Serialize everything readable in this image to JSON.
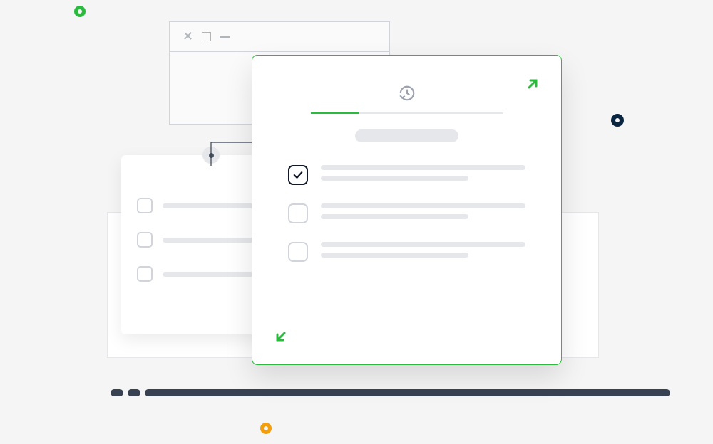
{
  "decorations": {
    "dots": [
      "green-ring",
      "navy-ring",
      "orange-ring"
    ]
  },
  "wire_window": {
    "controls": [
      "close",
      "maximize",
      "minimize"
    ]
  },
  "left_card": {
    "items": [
      {
        "checked": false
      },
      {
        "checked": false
      },
      {
        "checked": false
      }
    ]
  },
  "main_card": {
    "icon": "history-clock-icon",
    "progress_segment_active": 1,
    "header_pill": "placeholder",
    "items": [
      {
        "checked": true,
        "lines": 2
      },
      {
        "checked": false,
        "lines": 2
      },
      {
        "checked": false,
        "lines": 2
      }
    ],
    "expand": {
      "top_right": "arrow-up-right",
      "bottom_left": "arrow-down-left"
    }
  },
  "bottom_track": {
    "segments": 3
  }
}
